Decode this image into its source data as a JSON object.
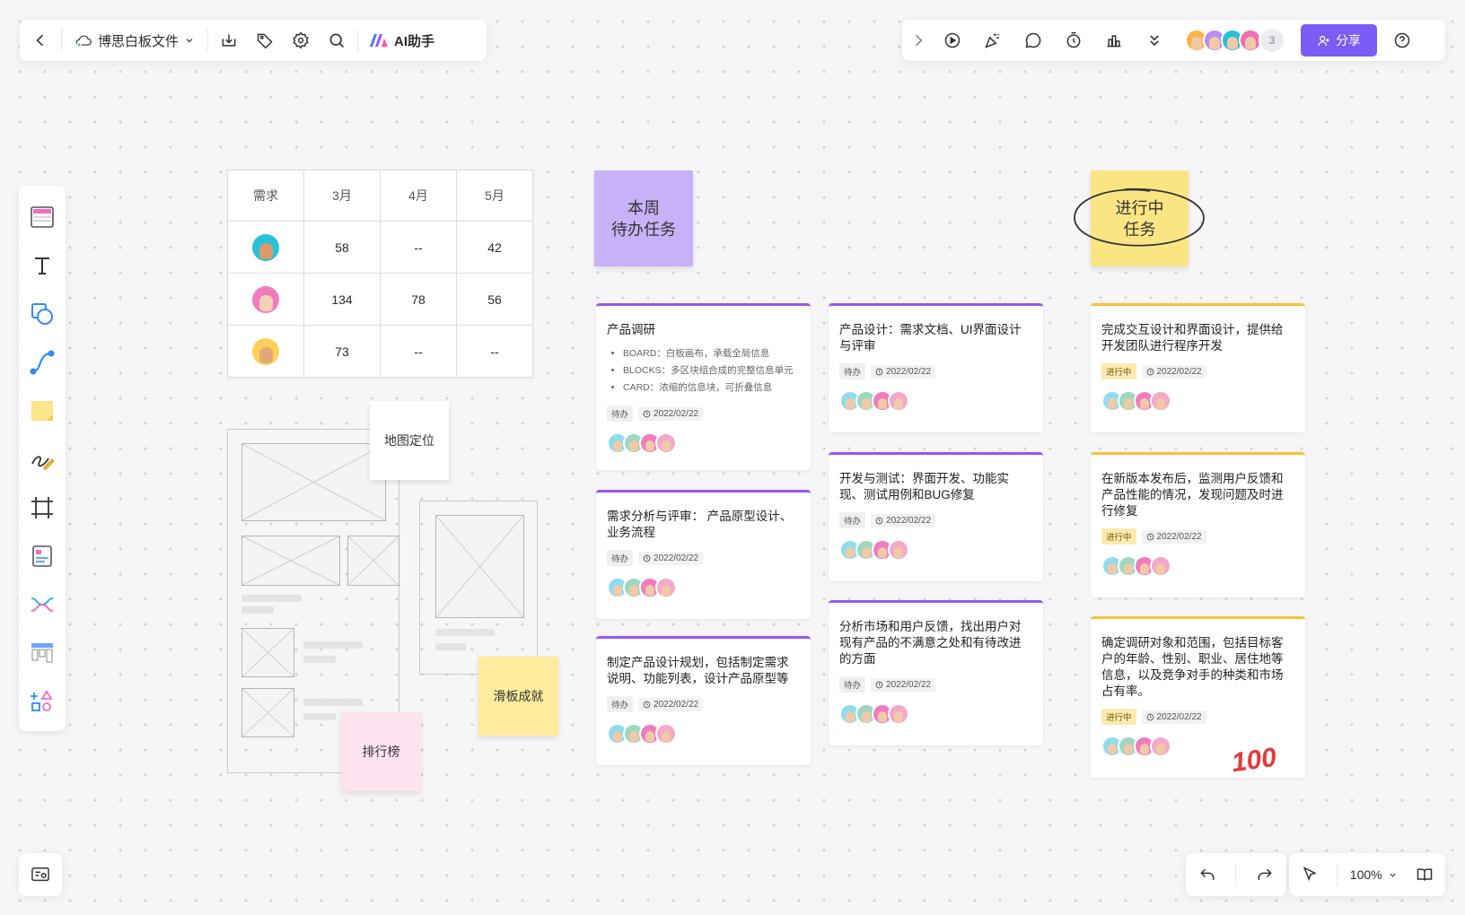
{
  "toolbar_left": {
    "file_name": "博思白板文件",
    "ai_label": "AI助手"
  },
  "toolbar_right": {
    "avatar_more_count": "3",
    "share_label": "分享",
    "avatar_colors": [
      "#ffb24a",
      "#b98cf5",
      "#25c1d8",
      "#f26fb4"
    ]
  },
  "zoom": {
    "level": "100%"
  },
  "table": {
    "headers": [
      "需求",
      "3月",
      "4月",
      "5月"
    ],
    "rows": [
      {
        "avatar_color": "#27c2d9",
        "values": [
          "58",
          "--",
          "42"
        ]
      },
      {
        "avatar_color": "#f07cc0",
        "values": [
          "134",
          "78",
          "56"
        ]
      },
      {
        "avatar_color": "#ffcf5a",
        "values": [
          "73",
          "--",
          "--"
        ]
      }
    ]
  },
  "wireframe": {
    "map_label": "地图定位",
    "ranking_label": "排行榜",
    "skate_label": "滑板成就"
  },
  "columns": {
    "todo_header": "本周\n待办任务",
    "doing_header": "进行中\n任务"
  },
  "cards": [
    {
      "title": "产品调研",
      "bullets": [
        "BOARD：白板画布，承载全局信息",
        "BLOCKS：多区块组合成的完整信息单元",
        "CARD：浓缩的信息块，可折叠信息"
      ],
      "tag": "待办",
      "date": "2022/02/22"
    },
    {
      "title": "需求分析与评审： 产品原型设计、业务流程",
      "tag": "待办",
      "date": "2022/02/22"
    },
    {
      "title": "制定产品设计规划，包括制定需求说明、功能列表，设计产品原型等",
      "tag": "待办",
      "date": "2022/02/22"
    },
    {
      "title": "产品设计：需求文档、UI界面设计与评审",
      "tag": "待办",
      "date": "2022/02/22"
    },
    {
      "title": "开发与测试：界面开发、功能实现、测试用例和BUG修复",
      "tag": "待办",
      "date": "2022/02/22"
    },
    {
      "title": "分析市场和用户反馈，找出用户对现有产品的不满意之处和有待改进的方面",
      "tag": "待办",
      "date": "2022/02/22"
    },
    {
      "title": "完成交互设计和界面设计，提供给开发团队进行程序开发",
      "tag": "进行中",
      "date": "2022/02/22"
    },
    {
      "title": "在新版本发布后，监测用户反馈和产品性能的情况，发现问题及时进行修复",
      "tag": "进行中",
      "date": "2022/02/22"
    },
    {
      "title": "确定调研对象和范围，包括目标客户的年龄、性别、职业、居住地等信息，以及竞争对手的种类和市场占有率。",
      "tag": "进行中",
      "date": "2022/02/22"
    }
  ],
  "card_avatar_colors": [
    "#8fdcef",
    "#9ed7c0",
    "#f07cc0",
    "#f3a9c9"
  ],
  "emoji": "100"
}
